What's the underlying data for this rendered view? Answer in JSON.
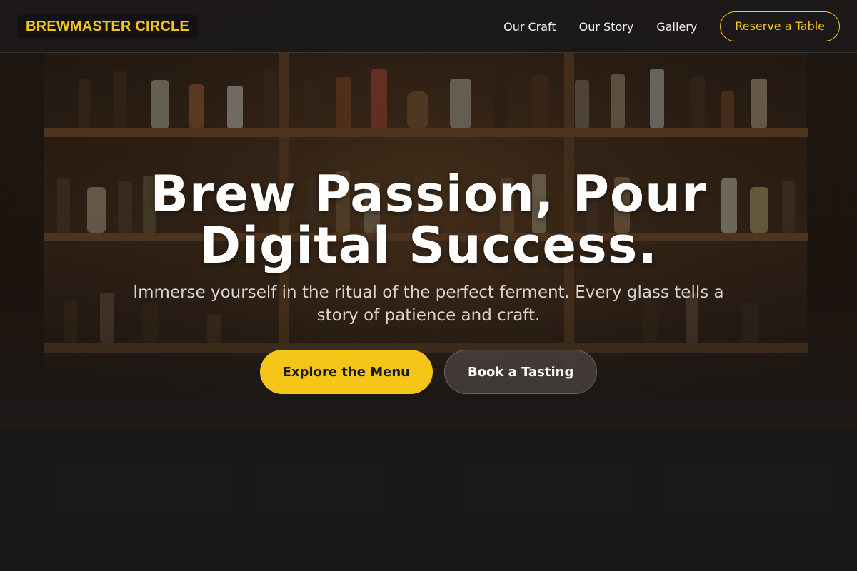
{
  "brand": {
    "name": "BREWMASTER CIRCLE"
  },
  "nav": {
    "links": [
      "Our Craft",
      "Our Story",
      "Gallery"
    ],
    "cta": "Reserve a Table"
  },
  "hero": {
    "title": "Brew Passion, Pour Digital Success.",
    "subtitle": "Immerse yourself in the ritual of the perfect ferment. Every glass tells a story of patience and craft.",
    "primary_button": "Explore the Menu",
    "secondary_button": "Book a Tasting"
  },
  "colors": {
    "accent": "#f5c518",
    "background": "#1a1817",
    "nav_text": "#f2f0ee"
  },
  "background_image": "bar-shelves-with-bottles"
}
